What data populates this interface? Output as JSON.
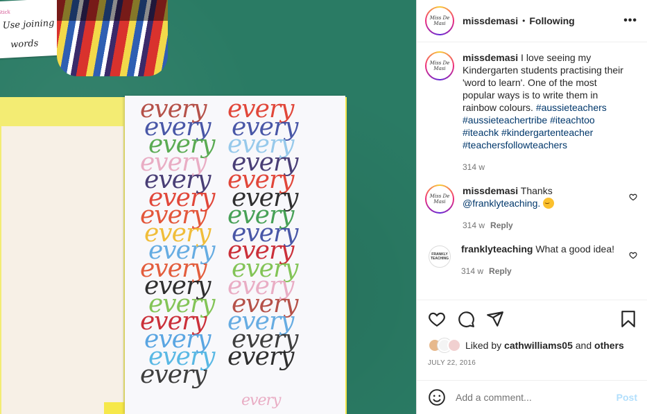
{
  "photo": {
    "card_text_line1": "Use joining",
    "card_text_line2": "words",
    "card_tag": "Stick",
    "word": "every"
  },
  "post": {
    "username": "missdemasi",
    "separator": "•",
    "follow_status": "Following",
    "more_label": "•••",
    "avatar_text": "Miss De Masi"
  },
  "caption": {
    "username": "missdemasi",
    "text": " I love seeing my Kindergarten students practising their 'word to learn'. One of the most popular ways is to write them in rainbow colours. ",
    "hashtags": "#aussieteachers #aussieteachertribe #iteachtoo #iteachk #kindergartenteacher #teachersfollowteachers",
    "time": "314 w"
  },
  "comments": [
    {
      "username": "missdemasi",
      "text": " Thanks ",
      "mention": "@franklyteaching.",
      "time": "314 w",
      "reply": "Reply",
      "avatar_text": "Miss De Masi"
    },
    {
      "username": "franklyteaching",
      "text": " What a good idea!",
      "time": "314 w",
      "reply": "Reply",
      "avatar_text": "FRANKLY TEACHING"
    }
  ],
  "likes": {
    "prefix": "Liked by ",
    "user": "cathwilliams05",
    "middle": " and ",
    "others": "others"
  },
  "date": "JULY 22, 2016",
  "add_comment": {
    "placeholder": "Add a comment...",
    "post_label": "Post"
  },
  "icons": [
    "heart-icon",
    "comment-icon",
    "share-icon",
    "bookmark-icon",
    "emoji-icon",
    "more-icon"
  ]
}
